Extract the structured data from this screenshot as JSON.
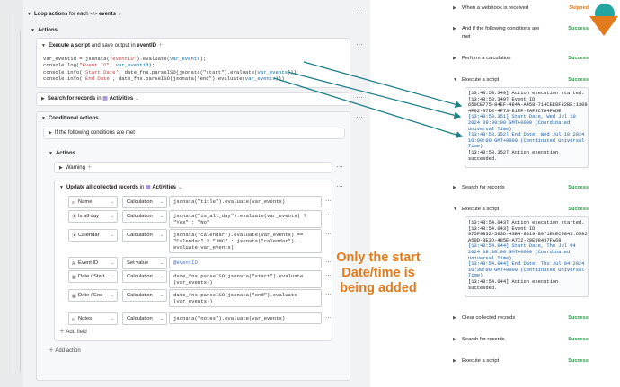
{
  "loop": {
    "label": "Loop actions",
    "for_each": "for each",
    "events": "events"
  },
  "actions_label": "Actions",
  "execute": {
    "label": "Execute a script",
    "save": "and save output in",
    "var": "eventID"
  },
  "script_lines": [
    {
      "a": "var_eventid = jsonata(",
      "s1": "\"eventID\"",
      "b": ").evaluate(",
      "v": "var_events",
      "c": ");"
    },
    {
      "a": "console.log(",
      "s1": "\"Event ID\"",
      "b": ", ",
      "v": "var_eventid",
      "c": ");"
    },
    {
      "a": "console.info(",
      "s1": "'Start Date'",
      "b": ", date_fns.parseISO(jsonata(\"start\").evaluate(",
      "v": "var_events",
      "c": ")))"
    },
    {
      "a": "console.info(",
      "s1": "'End Date'",
      "b": ", date_fns.parseISO(jsonata(\"end\").evaluate(",
      "v": "var_events",
      "c": ")))"
    }
  ],
  "search": {
    "label": "Search for records",
    "in": "in",
    "table": "Activities"
  },
  "conditional": {
    "label": "Conditional actions",
    "if": "If the following conditions are met",
    "actions": "Actions",
    "warning": "Warning"
  },
  "update": {
    "label": "Update all collected records",
    "in": "in",
    "table": "Activities"
  },
  "fields": [
    {
      "name": "Name",
      "icon": "≡",
      "op": "Calculation",
      "expr": [
        "jsonata(\"title\").evaluate(var_events)"
      ]
    },
    {
      "name": "Is all day",
      "icon": "⦿",
      "op": "Calculation",
      "expr": [
        "jsonata(\"is_all_day\").evaluate(var_events) ?",
        "\"Yes\" : \"No\""
      ]
    },
    {
      "name": "Calendar",
      "icon": "⦿",
      "op": "Calculation",
      "expr": [
        "jsonata(\"calendar\").evaluate(var_events) ==",
        "\"Calendar\" ? \"JMC\" : jsonata(\"calendar\").",
        "evaluate(var_events)"
      ]
    },
    {
      "name": "Event ID",
      "icon": "A",
      "op": "Set value",
      "expr": [
        "@eventID"
      ]
    },
    {
      "name": "Date / Start",
      "icon": "▦",
      "op": "Calculation",
      "expr": [
        "date_fns.parseISO(jsonata(\"start\").evaluate",
        "(var_events))"
      ]
    },
    {
      "name": "Date / End",
      "icon": "▦",
      "op": "Calculation",
      "expr": [
        "date_fns.parseISO(jsonata(\"end\").evaluate",
        "(var_events))"
      ]
    },
    {
      "name": "Notes",
      "icon": "≡",
      "op": "Calculation",
      "expr": [
        "jsonata(\"notes\").evaluate(var_events)"
      ]
    }
  ],
  "add_field": "Add field",
  "add_action": "Add action",
  "annotation": [
    "Only the start",
    "Date/time is",
    "being added"
  ],
  "right": {
    "items": [
      {
        "label": "When a webhook is received",
        "status": "Skipped"
      },
      {
        "label": "And if the following conditions are",
        "label2": "met",
        "status": "Success"
      },
      {
        "label": "Perform a calculation",
        "status": "Success"
      },
      {
        "label": "Execute a script",
        "status": "Success"
      },
      {
        "label": "Search for records",
        "status": "Success"
      },
      {
        "label": "Execute a script",
        "status": "Success"
      },
      {
        "label": "Clear collected records",
        "status": "Success"
      },
      {
        "label": "Search for records",
        "status": "Success"
      },
      {
        "label": "Execute a script",
        "status": "Success"
      }
    ],
    "log1": [
      "[13:48:53.349] Action execution started.",
      "[13:48:53.349] Event ID,",
      "650CE775-84EF-484A-A458-714CEE8F32BE:1308",
      "4F02-87DE-4F73-81EF-EAF8C7D4F6DE",
      "[13:48:53.351] Start Date, Wed Jul 10",
      "2024 09:00:00 GMT+0000 (Coordinated",
      "Universal Time)",
      "[13:48:53.352] End Date, Wed Jul 10 2024",
      "10:00:00 GMT+0000 (Coordinated Universal",
      "Time)",
      "[13:48:53.352] Action execution",
      "succeeded."
    ],
    "log2": [
      "[13:48:54.043] Action execution started.",
      "[13:48:54.043] Event ID,",
      "975F9932-593D-43B4-8019-8971ECEC9845:6592",
      "A50D-8E3D-485E-A7C2-20E98437FA68",
      "[13:48:54.044] Start Date, Thu Jul 04",
      "2024 08:30:00 GMT+0000 (Coordinated",
      "Universal Time)",
      "[13:48:54.044] End Date, Thu Jul 04 2024",
      "10:30:00 GMT+0000 (Coordinated Universal",
      "Time)",
      "[13:48:54.044] Action execution",
      "succeeded."
    ]
  },
  "colors": {
    "accent": "#1f7f86",
    "annotation": "#e27b1c",
    "success": "#2e9c46",
    "skipped": "#e27b1c"
  }
}
